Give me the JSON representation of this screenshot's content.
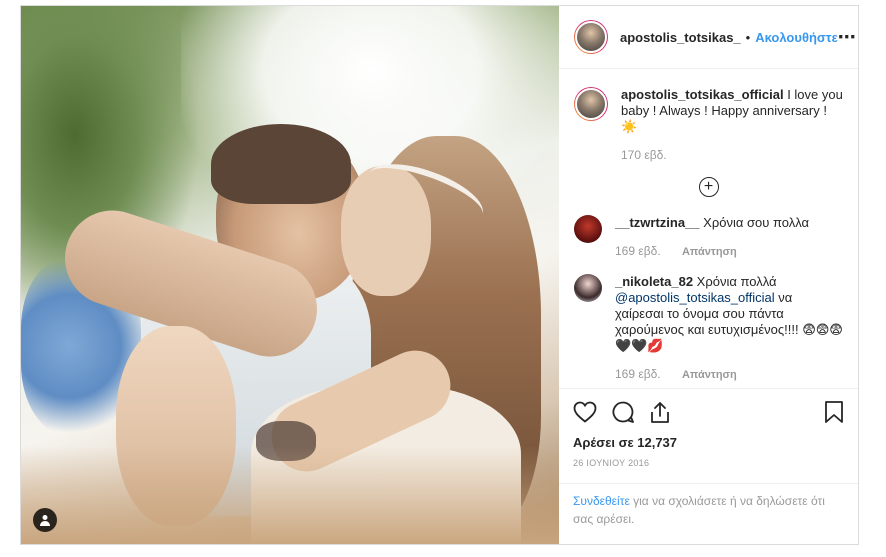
{
  "post": {
    "author": "apostolis_totsikas_",
    "separator": "•",
    "follow_label": "Ακολουθήστε",
    "more_icon": "more-icon",
    "caption": {
      "author": "apostolis_totsikas_official",
      "text": "I love you baby ! Always ! Happy anniversary ! ☀️",
      "time": "170 εβδ."
    },
    "comments": [
      {
        "author": "__tzwrtzina__",
        "text": "Χρόνια σου πολλα",
        "time": "169 εβδ.",
        "reply_label": "Απάντηση"
      },
      {
        "author": "_nikoleta_82",
        "text_prefix": "Χρόνια πολλά",
        "mention": "@apostolis_totsikas_official",
        "text_suffix": "να χαίρεσαι το όνομα σου πάντα χαρούμενος και ευτυχισμένος!!!! 😨😨😨🖤🖤💋",
        "time": "169 εβδ.",
        "reply_label": "Απάντηση"
      }
    ],
    "likes": "Αρέσει σε 12,737",
    "date": "26 ΙΟΥΝΙΟΥ 2016",
    "login_link": "Συνδεθείτε",
    "login_text": "για να σχολιάσετε ή να δηλώσετε ότι σας αρέσει.",
    "colors": {
      "accent": "#3897f0",
      "border": "#dbdbdb",
      "muted": "#999999"
    }
  }
}
